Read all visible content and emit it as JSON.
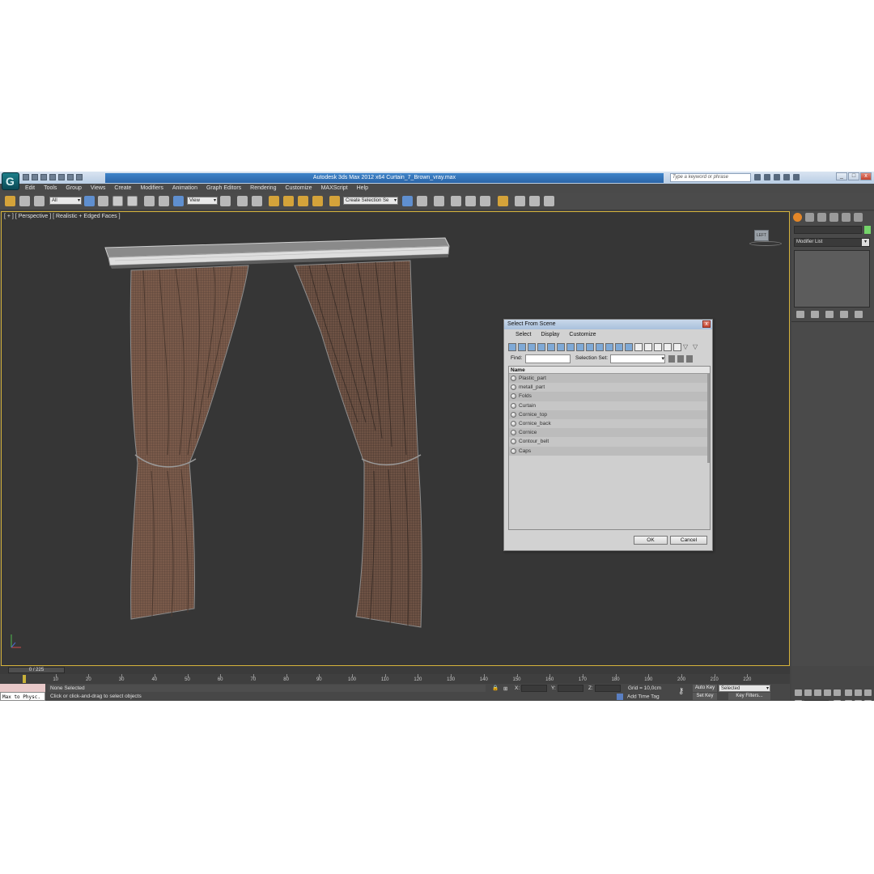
{
  "app": {
    "title": "Autodesk 3ds Max  2012 x64      Curtain_7_Brown_vray.max",
    "search_placeholder": "Type a keyword or phrase",
    "logo_letter": "G"
  },
  "menu": [
    "Edit",
    "Tools",
    "Group",
    "Views",
    "Create",
    "Modifiers",
    "Animation",
    "Graph Editors",
    "Rendering",
    "Customize",
    "MAXScript",
    "Help"
  ],
  "toolbar": {
    "filter_value": "All",
    "refcoord_value": "View",
    "selection_set_value": "Create Selection Se"
  },
  "viewport": {
    "label": "[ + ] [ Perspective ] [ Realistic + Edged Faces ]",
    "viewcube_label": "LEFT"
  },
  "command_panel": {
    "modifier_list": "Modifier List",
    "accent_color": "#74d46a"
  },
  "timeline": {
    "frame": "0 / 225",
    "ticks": [
      "10",
      "20",
      "30",
      "40",
      "50",
      "60",
      "70",
      "80",
      "90",
      "100",
      "110",
      "120",
      "130",
      "140",
      "150",
      "160",
      "170",
      "180",
      "190",
      "200",
      "210",
      "220"
    ]
  },
  "status": {
    "maxscript_label": "Max to Physc.",
    "selection": "None Selected",
    "prompt": "Click or click-and-drag to select objects",
    "x_label": "X:",
    "y_label": "Y:",
    "z_label": "Z:",
    "grid": "Grid = 10,0cm",
    "add_time_tag": "Add Time Tag",
    "auto_key": "Auto Key",
    "selected": "Selected",
    "set_key": "Set Key",
    "key_filters": "Key Filters...",
    "frame_value": "0"
  },
  "dialog": {
    "title": "Select From Scene",
    "close": "x",
    "menu": [
      "Select",
      "Display",
      "Customize"
    ],
    "find_label": "Find:",
    "selection_set_label": "Selection Set:",
    "column_name": "Name",
    "items": [
      "Plastic_part",
      "metall_part",
      "Folds",
      "Curtain",
      "Cornice_top",
      "Cornice_back",
      "Cornice",
      "Contour_belt",
      "Caps"
    ],
    "ok": "OK",
    "cancel": "Cancel"
  }
}
